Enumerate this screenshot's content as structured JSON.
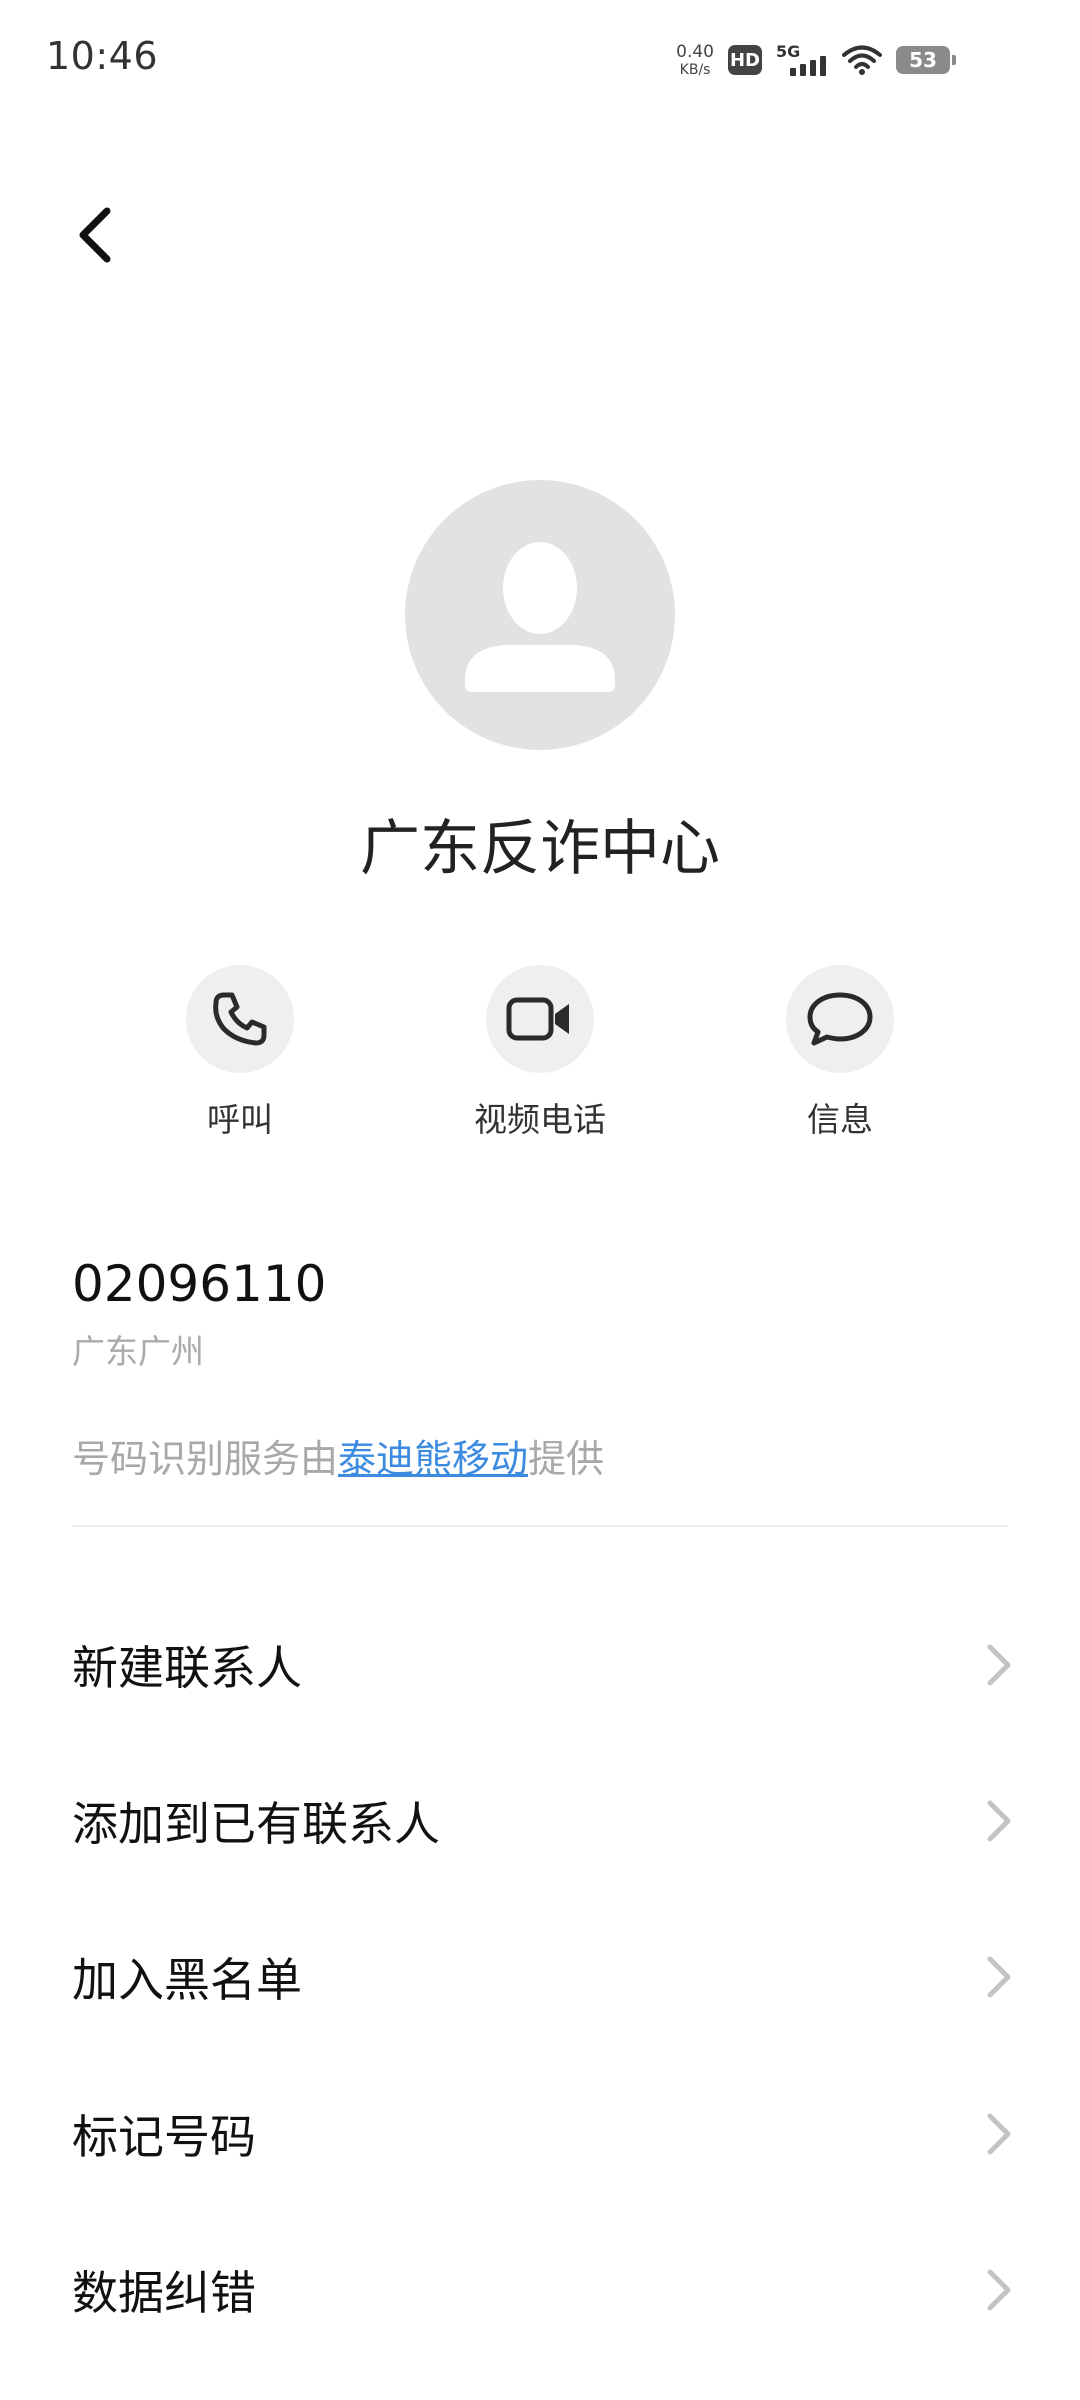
{
  "status_bar": {
    "time": "10:46",
    "net_speed_value": "0.40",
    "net_speed_unit": "KB/s",
    "hd": "HD",
    "network": "5G",
    "battery": "53"
  },
  "contact": {
    "name": "广东反诈中心"
  },
  "actions": [
    {
      "label": "呼叫",
      "icon": "phone-icon"
    },
    {
      "label": "视频电话",
      "icon": "video-camera-icon"
    },
    {
      "label": "信息",
      "icon": "message-bubble-icon"
    }
  ],
  "number": {
    "value": "02096110",
    "location": "广东广州"
  },
  "provider": {
    "prefix": "号码识别服务由",
    "link": "泰迪熊移动",
    "suffix": "提供"
  },
  "menu": [
    {
      "label": "新建联系人"
    },
    {
      "label": "添加到已有联系人"
    },
    {
      "label": "加入黑名单"
    },
    {
      "label": "标记号码"
    },
    {
      "label": "数据纠错"
    }
  ],
  "colors": {
    "link": "#3d8be0",
    "secondary_text": "#a8a8a8",
    "avatar_bg": "#e2e2e2",
    "action_bg": "#efefef"
  }
}
